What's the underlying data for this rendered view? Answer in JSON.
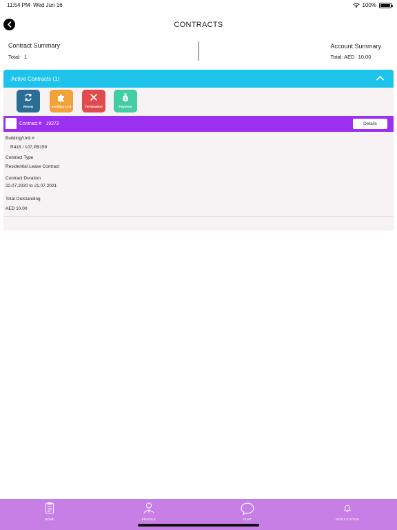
{
  "status_bar": {
    "time": "11:54 PM",
    "date": "Wed Jun 16",
    "battery": "100%"
  },
  "header": {
    "title": "CONTRACTS"
  },
  "summary": {
    "contract_title": "Contract Summary",
    "contract_total_label": "Total:",
    "contract_total_value": "1",
    "account_title": "Account Summary",
    "account_total_label": "Total: AED",
    "account_total_value": "10.00"
  },
  "panel": {
    "title": "Active Contracts (1)",
    "actions": [
      {
        "label": "Renew",
        "icon": "refresh-icon",
        "color": "#2a6e96"
      },
      {
        "label": "Ancillary Unit",
        "icon": "puzzle-icon",
        "color": "#f3a23a"
      },
      {
        "label": "Termination",
        "icon": "close-icon",
        "color": "#e04c4c"
      },
      {
        "label": "Payment",
        "icon": "money-bag-icon",
        "color": "#43cda2"
      }
    ],
    "contract": {
      "label": "Contract #",
      "number": "19272",
      "details_label": "Details",
      "fields": [
        {
          "label": "Building/Unit #",
          "value": "R416 / 107,PB159"
        },
        {
          "label": "Contract Type",
          "value": "Residential Lease Contract"
        },
        {
          "label": "Contract Duration",
          "value": "22.07.2020 to 21.07.2021"
        },
        {
          "label": "Total Outstanding",
          "value": "AED 10.00"
        }
      ]
    }
  },
  "tab_bar": {
    "items": [
      {
        "label": "HOME",
        "icon": "clipboard-icon"
      },
      {
        "label": "PROFILE",
        "icon": "user-icon"
      },
      {
        "label": "CHAT",
        "icon": "chat-bubble-icon"
      },
      {
        "label": "NOTIFICATION",
        "icon": "bell-icon"
      }
    ]
  },
  "colors": {
    "header_bar": "#1ec3ec",
    "contract_bar": "#9b30f0",
    "tab_bar": "#c77fe6"
  }
}
